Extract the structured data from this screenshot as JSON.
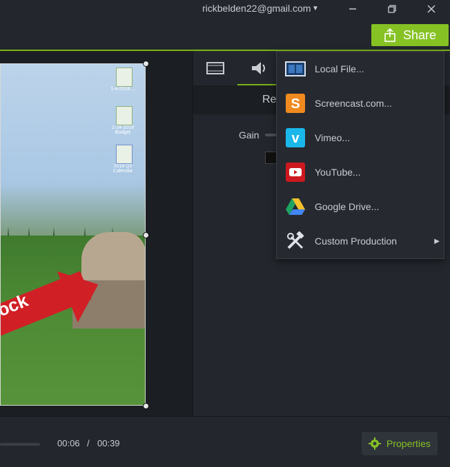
{
  "titlebar": {
    "account": "rickbelden22@gmail.com",
    "share_label": "Share"
  },
  "desktop_icons": [
    {
      "label": "1-4-2018 ..."
    },
    {
      "label": "1-24-2018 Budget"
    },
    {
      "label": "2018 Q2 Calendar"
    }
  ],
  "preview": {
    "overlay_text": "ock"
  },
  "panel": {
    "tabs": [
      {
        "icon": "film-icon"
      },
      {
        "icon": "speaker-icon"
      }
    ],
    "section_title": "Re",
    "gain_label": "Gain"
  },
  "share_menu": {
    "items": [
      {
        "label": "Local File...",
        "icon": "local-file-icon"
      },
      {
        "label": "Screencast.com...",
        "icon": "screencast-icon"
      },
      {
        "label": "Vimeo...",
        "icon": "vimeo-icon"
      },
      {
        "label": "YouTube...",
        "icon": "youtube-icon"
      },
      {
        "label": "Google Drive...",
        "icon": "google-drive-icon"
      },
      {
        "label": "Custom Production",
        "icon": "tools-icon",
        "has_submenu": true
      }
    ]
  },
  "playback": {
    "current_time": "00:06",
    "separator": "/",
    "total_time": "00:39"
  },
  "properties": {
    "label": "Properties"
  },
  "colors": {
    "accent": "#86c224",
    "background": "#1e2126",
    "panel": "#23272d"
  }
}
